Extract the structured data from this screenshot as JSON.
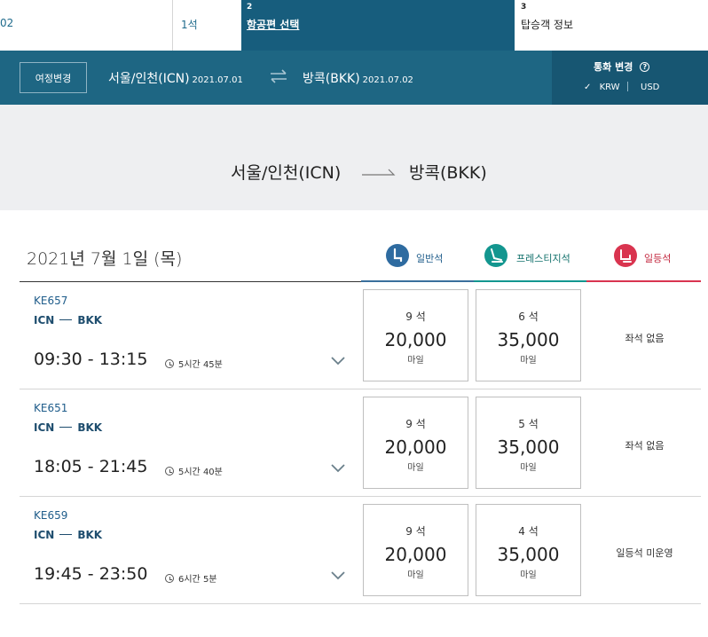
{
  "steps": [
    {
      "num": "",
      "label": "02"
    },
    {
      "num": "",
      "label": "1석"
    },
    {
      "num": "2",
      "label": "항공편 선택"
    },
    {
      "num": "3",
      "label": "탑승객 정보"
    }
  ],
  "route_bar": {
    "change_label": "여정변경",
    "from": "서울/인천(ICN)",
    "from_date": "2021.07.01",
    "to": "방콕(BKK)",
    "to_date": "2021.07.02",
    "currency_title": "통화 변경",
    "currency_help": "?",
    "currency_selected_mark": "✓",
    "currency_krw": "KRW",
    "currency_usd": "USD"
  },
  "summary": {
    "from": "서울/인천(ICN)",
    "to": "방콕(BKK)"
  },
  "date_heading": "2021년 7월 1일 (목)",
  "tabs": {
    "economy": "일반석",
    "prestige": "프레스티지석",
    "first": "일등석"
  },
  "colors": {
    "primary": "#1e6683",
    "active_step": "#175d7d",
    "economy": "#2e6ba0",
    "prestige": "#13968f",
    "first": "#d9344f"
  },
  "flights": [
    {
      "number": "KE657",
      "origin": "ICN",
      "dest": "BKK",
      "time": "09:30 - 13:15",
      "duration": "5시간 45분",
      "economy": {
        "seats": "9 석",
        "miles": "20,000",
        "unit": "마일"
      },
      "prestige": {
        "seats": "6 석",
        "miles": "35,000",
        "unit": "마일"
      },
      "first": "좌석 없음"
    },
    {
      "number": "KE651",
      "origin": "ICN",
      "dest": "BKK",
      "time": "18:05 - 21:45",
      "duration": "5시간 40분",
      "economy": {
        "seats": "9 석",
        "miles": "20,000",
        "unit": "마일"
      },
      "prestige": {
        "seats": "5 석",
        "miles": "35,000",
        "unit": "마일"
      },
      "first": "좌석 없음"
    },
    {
      "number": "KE659",
      "origin": "ICN",
      "dest": "BKK",
      "time": "19:45 - 23:50",
      "duration": "6시간 5분",
      "economy": {
        "seats": "9 석",
        "miles": "20,000",
        "unit": "마일"
      },
      "prestige": {
        "seats": "4 석",
        "miles": "35,000",
        "unit": "마일"
      },
      "first": "일등석 미운영"
    }
  ]
}
